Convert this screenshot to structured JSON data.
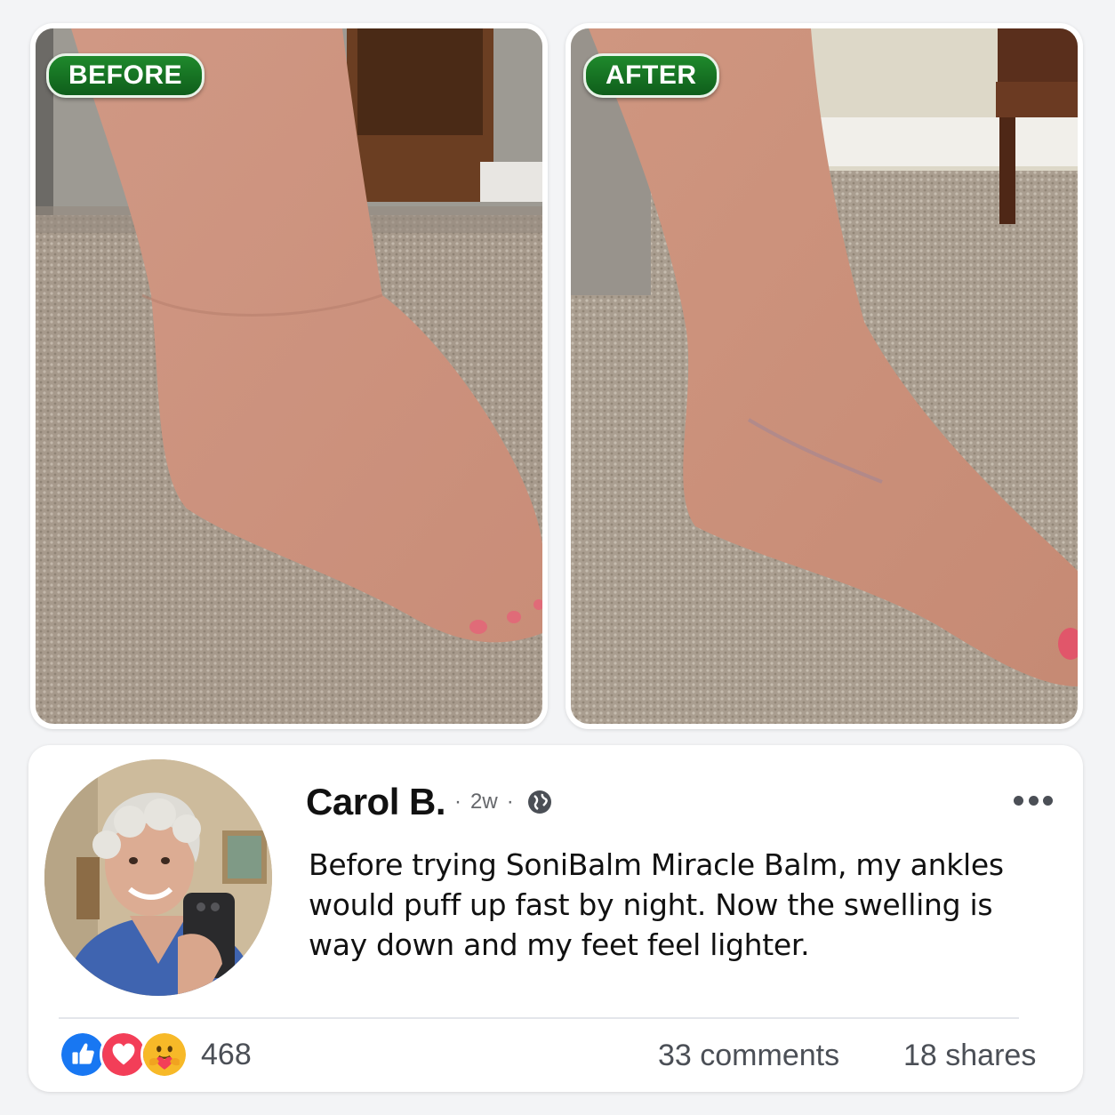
{
  "photos": {
    "before_label": "BEFORE",
    "after_label": "AFTER"
  },
  "post": {
    "author": "Carol B.",
    "time": "2w",
    "separator": "·",
    "privacy_icon": "globe-icon",
    "more_icon": "more-options-icon",
    "text": "Before trying SoniBalm Miracle Balm, my ankles would puff up fast by night. Now the swelling is way down and my feet feel lighter.",
    "reactions": {
      "icons": [
        "like-icon",
        "love-icon",
        "care-icon"
      ],
      "count": "468"
    },
    "comments": "33 comments",
    "shares": "18 shares"
  },
  "colors": {
    "pill_green": "#1f8a2c",
    "like_blue": "#1877f2",
    "love_red": "#f33e58",
    "care_yellow": "#f7b928"
  }
}
